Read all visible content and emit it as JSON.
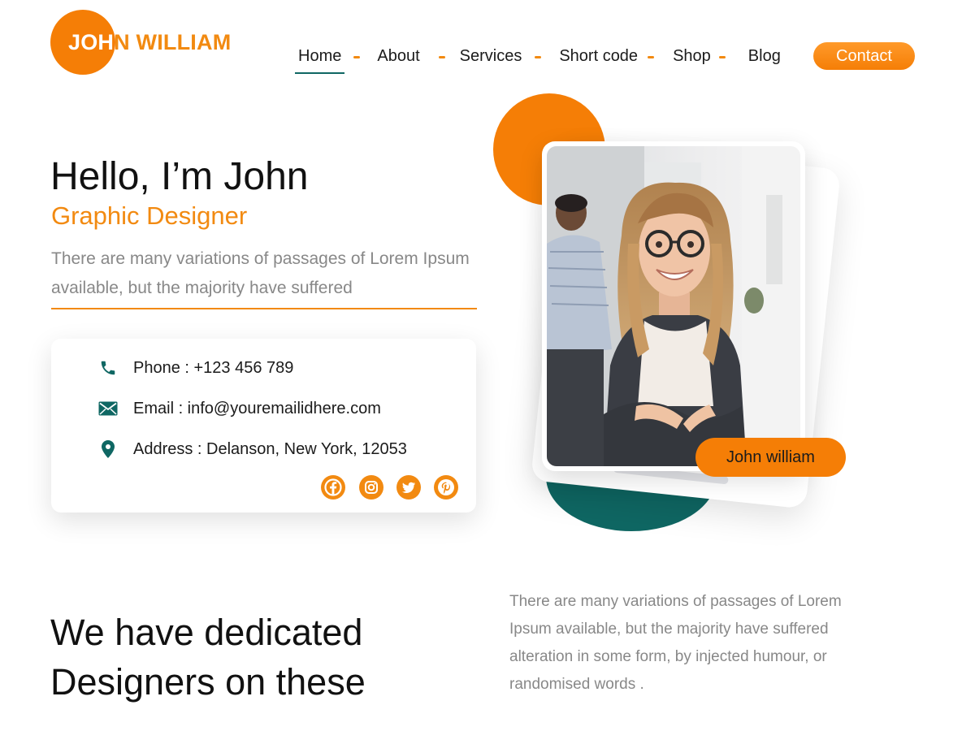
{
  "header": {
    "logo": {
      "text_white": "JOH",
      "text_orange": "N WILLIAM",
      "circle_color": "#f57e06"
    },
    "nav": {
      "items": [
        {
          "label": "Home",
          "active": true
        },
        {
          "label": "About"
        },
        {
          "label": "Services"
        },
        {
          "label": "Short code"
        },
        {
          "label": "Shop"
        },
        {
          "label": "Blog"
        }
      ],
      "contact_label": "Contact"
    }
  },
  "hero": {
    "greeting": "Hello, I’m John",
    "role": "Graphic Designer",
    "description": "There are many variations of passages of Lorem Ipsum available, but the majority have suffered",
    "contact": {
      "phone": "Phone : +123 456 789",
      "email": "Email : info@youremailidhere.com",
      "address": "Address : Delanson, New York, 12053"
    },
    "social_icons": [
      "facebook-icon",
      "instagram-icon",
      "twitter-icon",
      "pinterest-icon"
    ],
    "photo_badge": "John william"
  },
  "section": {
    "title": "We have dedicated Designers on these",
    "description": "There are many variations of passages of Lorem Ipsum available, but the majority have suffered alteration in some form, by injected humour, or randomised words ."
  },
  "colors": {
    "accent": "#f28a11",
    "accent_dark": "#f57e06",
    "teal": "#0f6763",
    "muted_text": "#888888"
  }
}
